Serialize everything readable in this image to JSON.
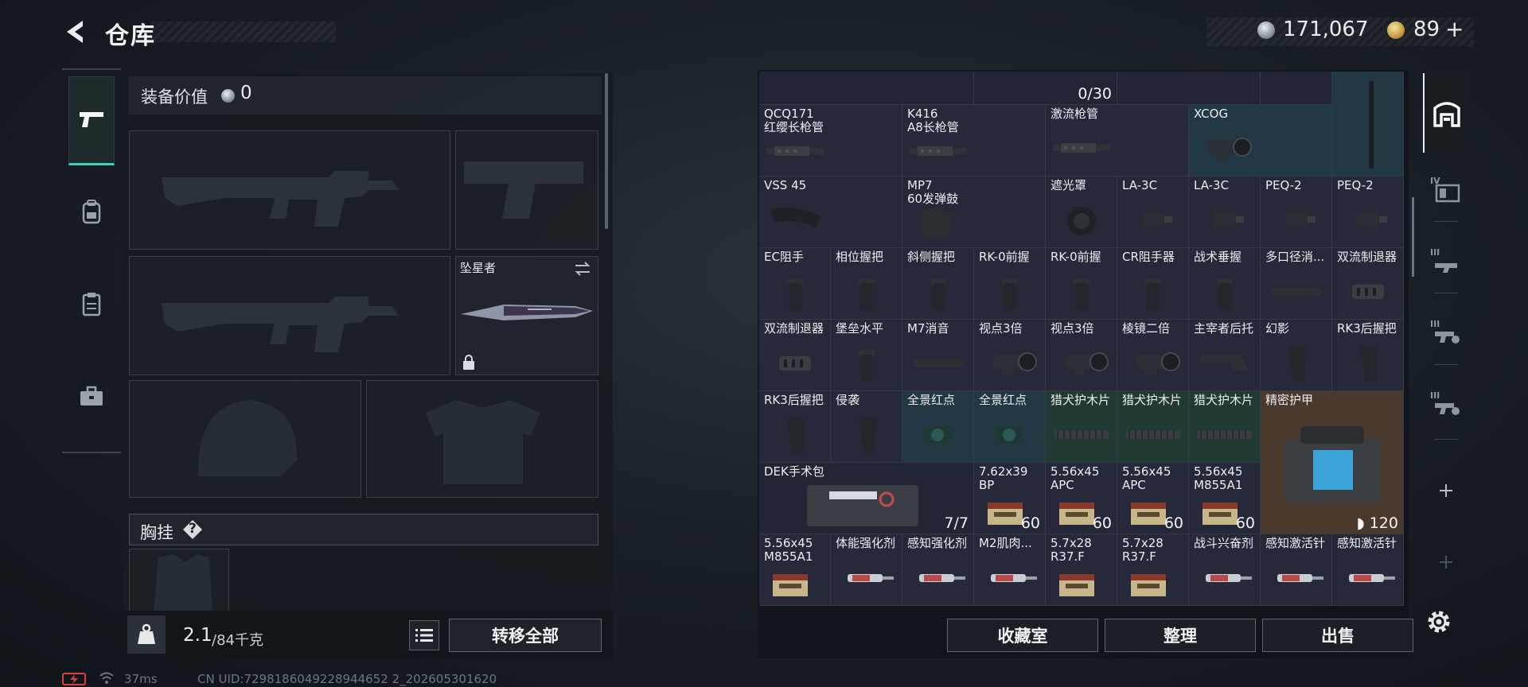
{
  "header": {
    "title": "仓库",
    "silver_amount": "171,067",
    "gold_amount": "89",
    "gold_plus": "+"
  },
  "left_tabs": [
    "weapons-tab",
    "gear-tab",
    "clipboard-tab",
    "case-tab"
  ],
  "equipment": {
    "value_label": "装备价值",
    "value_amount": "0",
    "melee_name": "坠星者",
    "chest_label": "胸挂",
    "chest_help": "?",
    "weight_value": "2.1",
    "weight_max": "/84千克",
    "transfer_all": "转移全部"
  },
  "stash": {
    "row0_count": "0/30",
    "cells": [
      {
        "name": "QCQ171\n红缨长枪管",
        "type": "barrel"
      },
      {
        "name": "K416\nA8长枪管",
        "type": "barrel"
      },
      {
        "name": "激流枪管",
        "type": "barrel"
      },
      {
        "name": "XCOG",
        "type": "scope"
      },
      {
        "name": "VSS 45",
        "type": "mag"
      },
      {
        "name": "MP7\n60发弹鼓",
        "type": "drum"
      },
      {
        "name": "遮光罩",
        "type": "hood"
      },
      {
        "name": "LA-3C",
        "type": "laser"
      },
      {
        "name": "LA-3C",
        "type": "laser"
      },
      {
        "name": "PEQ-2",
        "type": "laser"
      },
      {
        "name": "PEQ-2",
        "type": "laser"
      },
      {
        "name": "EC阻手",
        "type": "grip"
      },
      {
        "name": "相位握把",
        "type": "grip"
      },
      {
        "name": "斜侧握把",
        "type": "grip"
      },
      {
        "name": "RK-0前握",
        "type": "grip"
      },
      {
        "name": "RK-0前握",
        "type": "grip"
      },
      {
        "name": "CR阻手器",
        "type": "grip"
      },
      {
        "name": "战术垂握",
        "type": "grip"
      },
      {
        "name": "多口径消...",
        "type": "suppressor"
      },
      {
        "name": "双流制退器",
        "type": "brake"
      },
      {
        "name": "双流制退器",
        "type": "brake"
      },
      {
        "name": "堡垒水平",
        "type": "grip"
      },
      {
        "name": "M7消音",
        "type": "suppressor"
      },
      {
        "name": "视点3倍",
        "type": "scope"
      },
      {
        "name": "视点3倍",
        "type": "scope"
      },
      {
        "name": "棱镜二倍",
        "type": "scope"
      },
      {
        "name": "主宰者后托",
        "type": "stock"
      },
      {
        "name": "幻影",
        "type": "pgrip"
      },
      {
        "name": "RK3后握把",
        "type": "pgrip"
      },
      {
        "name": "RK3后握把",
        "type": "pgrip"
      },
      {
        "name": "侵袭",
        "type": "pgrip"
      },
      {
        "name": "全景红点",
        "type": "reddot"
      },
      {
        "name": "全景红点",
        "type": "reddot"
      },
      {
        "name": "猎犬护木片",
        "type": "rail"
      },
      {
        "name": "猎犬护木片",
        "type": "rail"
      },
      {
        "name": "猎犬护木片",
        "type": "rail"
      },
      {
        "name": "精密护甲",
        "type": "armorbag"
      },
      {
        "name": "DEK手术包",
        "type": "medkit"
      },
      {
        "name": "7.62x39\nBP",
        "type": "ammo"
      },
      {
        "name": "5.56x45\nAPC",
        "type": "ammo"
      },
      {
        "name": "5.56x45\nAPC",
        "type": "ammo"
      },
      {
        "name": "5.56x45\nM855A1",
        "type": "ammo"
      },
      {
        "name": "5.56x45\nM855A1",
        "type": "ammo"
      },
      {
        "name": "体能强化剂",
        "type": "syringe"
      },
      {
        "name": "感知强化剂",
        "type": "syringe"
      },
      {
        "name": "M2肌肉...",
        "type": "syringe"
      },
      {
        "name": "5.7x28\nR37.F",
        "type": "ammo"
      },
      {
        "name": "5.7x28\nR37.F",
        "type": "ammo"
      },
      {
        "name": "战斗兴奋剂",
        "type": "syringe"
      },
      {
        "name": "感知激活针",
        "type": "syringe"
      },
      {
        "name": "感知激活针",
        "type": "syringe"
      }
    ],
    "medkit_count": "7/7",
    "ammo_counts": [
      "60",
      "60",
      "60",
      "60"
    ],
    "armor_durability": "120"
  },
  "bottom_buttons": {
    "collection": "收藏室",
    "sort": "整理",
    "sell": "出售"
  },
  "status": {
    "ping": "37ms",
    "uid": "CN UID:7298186049228944652 2_202605301620"
  },
  "colors": {
    "accent": "#3ed1b6",
    "cell_default": "#26293a",
    "cell_teal": "#223845",
    "cell_green": "#223a34",
    "cell_orange": "#4a3a2e"
  }
}
